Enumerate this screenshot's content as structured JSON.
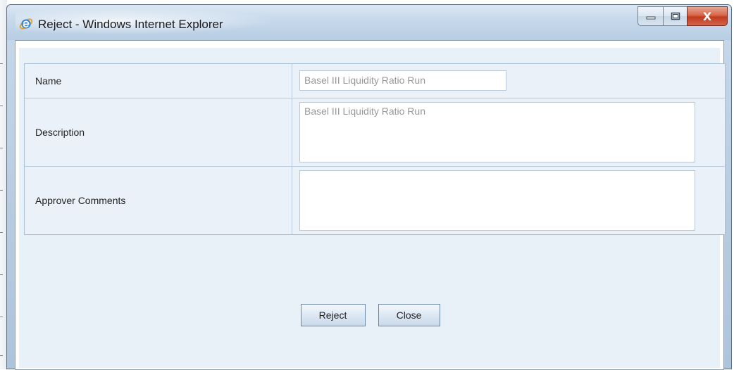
{
  "window": {
    "title": "Reject - Windows Internet Explorer",
    "minimize_icon": "minimize-icon",
    "maximize_icon": "maximize-icon",
    "close_label": "X"
  },
  "form": {
    "name": {
      "label": "Name",
      "value": "Basel III Liquidity Ratio Run"
    },
    "description": {
      "label": "Description",
      "value": "Basel III Liquidity Ratio Run"
    },
    "approver_comments": {
      "label": "Approver Comments",
      "value": ""
    }
  },
  "actions": {
    "reject_label": "Reject",
    "close_label": "Close"
  },
  "colors": {
    "title_bar": "#c6d8eb",
    "form_background": "#eaf1f8",
    "close_button": "#c23b1d",
    "disabled_text": "#999999"
  }
}
